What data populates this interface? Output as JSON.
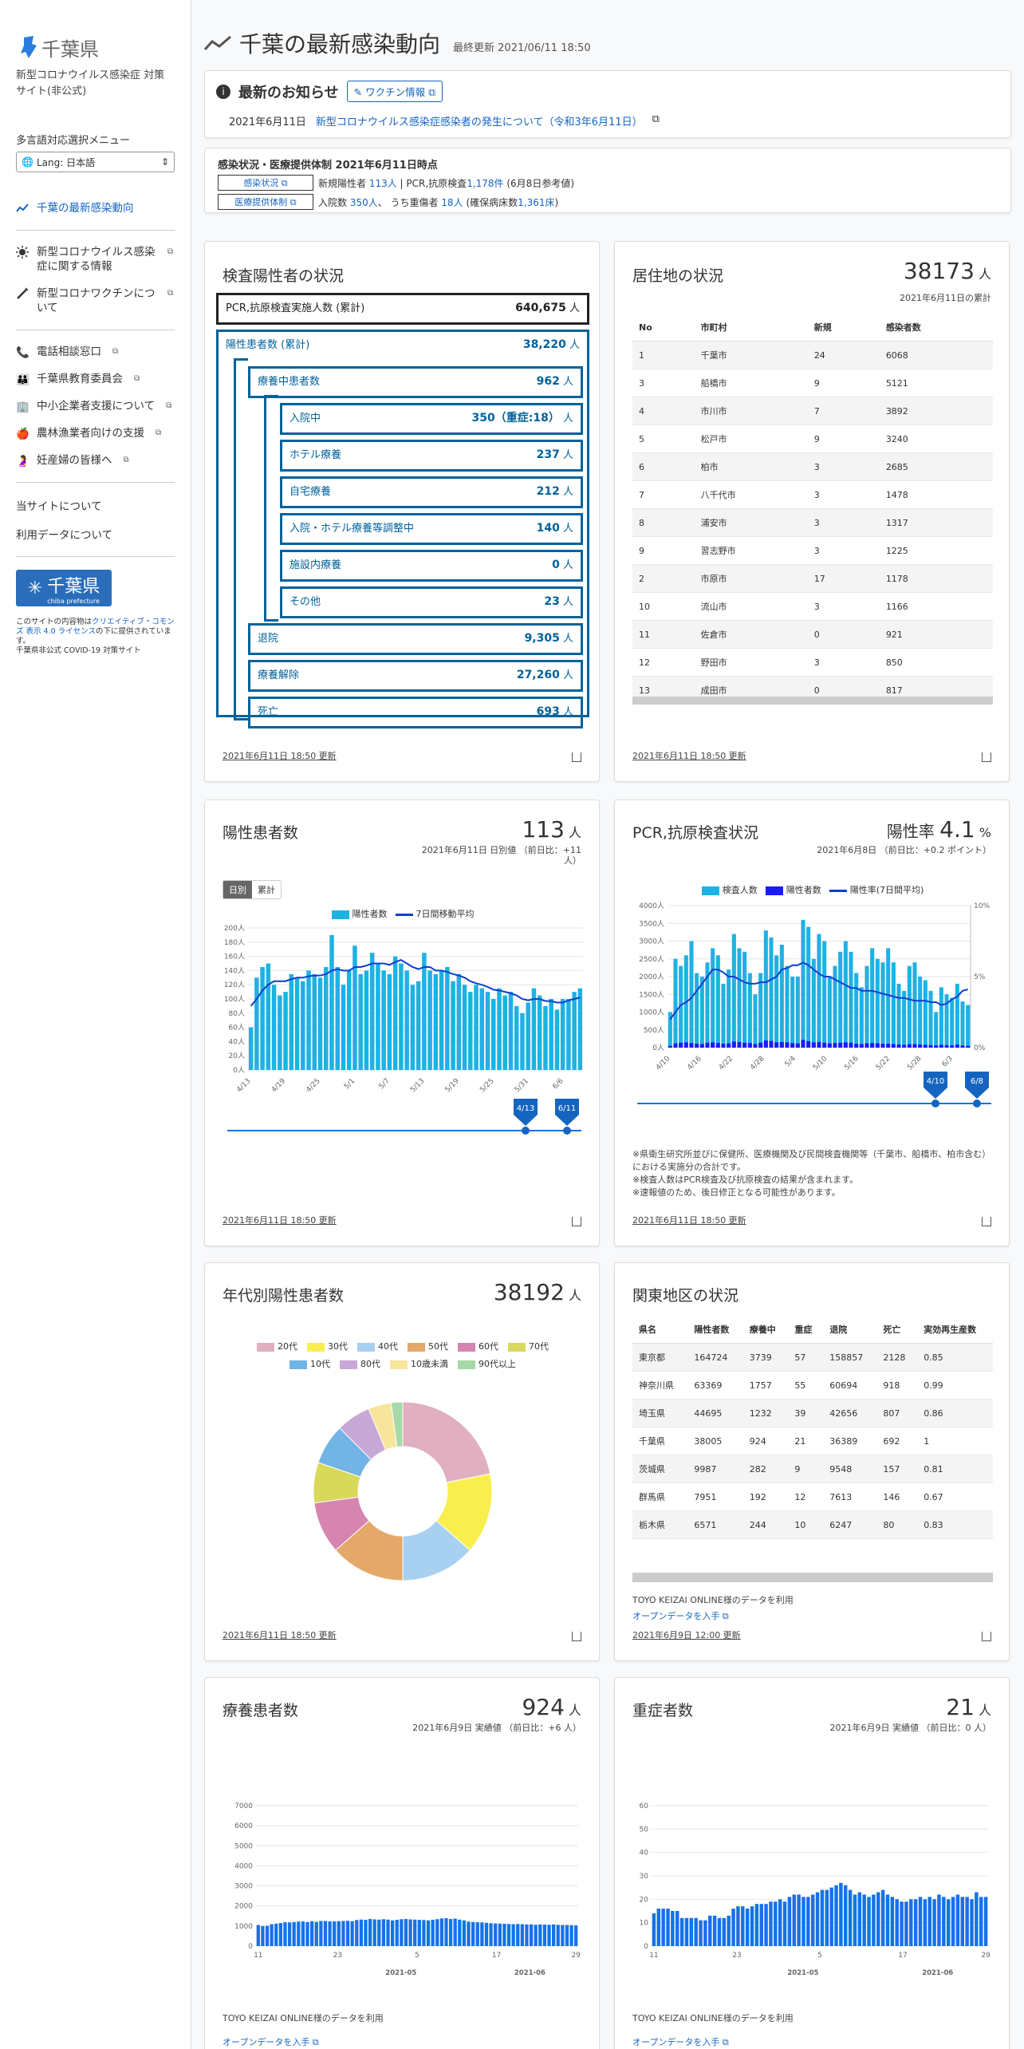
{
  "sidebar": {
    "logo": "千葉県",
    "site_sub": "新型コロナウイルス感染症 対策サイト(非公式)",
    "lang_title": "多言語対応選択メニュー",
    "lang_value": "Lang: 日本語",
    "nav": [
      {
        "label": "千葉の最新感染動向",
        "icon": "chart-line-icon"
      },
      {
        "label": "新型コロナウイルス感染症に関する情報",
        "icon": "sun-icon"
      },
      {
        "label": "新型コロナワクチンについて",
        "icon": "syringe-icon"
      }
    ],
    "nav2": [
      {
        "label": "電話相談窓口",
        "icon": "phone-icon"
      },
      {
        "label": "千葉県教育委員会",
        "icon": "family-icon"
      },
      {
        "label": "中小企業者支援について",
        "icon": "building-icon"
      },
      {
        "label": "農林漁業者向けの支援",
        "icon": "apple-icon"
      },
      {
        "label": "妊産婦の皆様へ",
        "icon": "pregnant-icon"
      }
    ],
    "about": "当サイトについて",
    "data_about": "利用データについて",
    "pref_logo": "千葉県",
    "pref_logo_sub": "chiba prefecture",
    "license_pre": "このサイトの内容物は",
    "license_link": "クリエイティブ・コモンズ 表示 4.0 ライセンス",
    "license_post": "の下に提供されています。",
    "license_last": "千葉県非公式 COVID-19 対策サイト"
  },
  "header": {
    "title": "千葉の最新感染動向",
    "updated": "最終更新 2021/06/11 18:50"
  },
  "news": {
    "title": "最新のお知らせ",
    "vaccine": "ワクチン情報",
    "date": "2021年6月11日",
    "link": "新型コロナウイルス感染症感染者の発生について（令和3年6月11日）"
  },
  "status": {
    "head": "感染状況・医療提供体制 2021年6月11日時点",
    "btn1": "感染状況",
    "btn2": "医療提供体制",
    "l1a": "新規陽性者 ",
    "l1b": "113人",
    "l1c": " | PCR,抗原検査",
    "l1d": "1,178件",
    "l1e": " (6月8日参考値)",
    "l2a": "入院数 ",
    "l2b": "350人",
    "l2c": "、 うち重傷者 ",
    "l2d": "18人",
    "l2e": " (確保病床数",
    "l2f": "1,361床",
    "l2g": ")"
  },
  "inspect": {
    "title": "検査陽性者の状況",
    "footer": "2021年6月11日 18:50 更新",
    "boxes": [
      {
        "label": "PCR,抗原検査実施人数 (累計)",
        "value": "640,675",
        "unit": " 人"
      },
      {
        "label": "陽性患者数 (累計)",
        "value": "38,220",
        "unit": " 人"
      },
      {
        "label": "療養中患者数",
        "value": "962",
        "unit": " 人"
      },
      {
        "label": "入院中",
        "value": "350（重症:18）",
        "unit": " 人"
      },
      {
        "label": "ホテル療養",
        "value": "237",
        "unit": " 人"
      },
      {
        "label": "自宅療養",
        "value": "212",
        "unit": " 人"
      },
      {
        "label": "入院・ホテル療養等調整中",
        "value": "140",
        "unit": " 人"
      },
      {
        "label": "施設内療養",
        "value": "0",
        "unit": " 人"
      },
      {
        "label": "その他",
        "value": "23",
        "unit": " 人"
      },
      {
        "label": "退院",
        "value": "9,305",
        "unit": " 人"
      },
      {
        "label": "療養解除",
        "value": "27,260",
        "unit": " 人"
      },
      {
        "label": "死亡",
        "value": "693",
        "unit": " 人"
      }
    ]
  },
  "residence": {
    "title": "居住地の状況",
    "big": "38173",
    "unit": " 人",
    "sub": "2021年6月11日の累計",
    "footer": "2021年6月11日 18:50 更新",
    "cols": [
      "No",
      "市町村",
      "新規",
      "感染者数"
    ],
    "rows": [
      [
        "1",
        "千葉市",
        "24",
        "6068"
      ],
      [
        "3",
        "船橋市",
        "9",
        "5121"
      ],
      [
        "4",
        "市川市",
        "7",
        "3892"
      ],
      [
        "5",
        "松戸市",
        "9",
        "3240"
      ],
      [
        "6",
        "柏市",
        "3",
        "2685"
      ],
      [
        "7",
        "八千代市",
        "3",
        "1478"
      ],
      [
        "8",
        "浦安市",
        "3",
        "1317"
      ],
      [
        "9",
        "習志野市",
        "3",
        "1225"
      ],
      [
        "2",
        "市原市",
        "17",
        "1178"
      ],
      [
        "10",
        "流山市",
        "3",
        "1166"
      ],
      [
        "11",
        "佐倉市",
        "0",
        "921"
      ],
      [
        "12",
        "野田市",
        "3",
        "850"
      ],
      [
        "13",
        "成田市",
        "0",
        "817"
      ]
    ]
  },
  "positive": {
    "title": "陽性患者数",
    "big": "113",
    "unit": " 人",
    "sub": "2021年6月11日 日別値 （前日比：+11 人）",
    "tog1": "日別",
    "tog2": "累計",
    "footer": "2021年6月11日 18:50 更新",
    "slider_left": "4/13",
    "slider_right": "6/11"
  },
  "pcr": {
    "title": "PCR,抗原検査状況",
    "ratio_label": "陽性率 ",
    "big": "4.1",
    "unit": " %",
    "sub": "2021年6月8日 （前日比：+0.2 ポイント）",
    "footer": "2021年6月11日 18:50 更新",
    "slider_left": "4/10",
    "slider_right": "6/8",
    "notes": [
      "※県衛生研究所並びに保健所、医療機関及び民間検査機関等（千葉市、船橋市、柏市含む）における実施分の合計です。",
      "※検査人数はPCR検査及び抗原検査の結果が含まれます。",
      "※速報値のため、後日修正となる可能性があります。"
    ]
  },
  "age": {
    "title": "年代別陽性患者数",
    "big": "38192",
    "unit": " 人",
    "footer": "2021年6月11日 18:50 更新"
  },
  "kanto": {
    "title": "関東地区の状況",
    "credit": "TOYO KEIZAI ONLINE様のデータを利用",
    "open": "オープンデータを入手",
    "footer": "2021年6月9日 12:00 更新",
    "cols": [
      "県名",
      "陽性者数",
      "療養中",
      "重症",
      "退院",
      "死亡",
      "実効再生産数"
    ],
    "rows": [
      [
        "東京都",
        "164724",
        "3739",
        "57",
        "158857",
        "2128",
        "0.85"
      ],
      [
        "神奈川県",
        "63369",
        "1757",
        "55",
        "60694",
        "918",
        "0.99"
      ],
      [
        "埼玉県",
        "44695",
        "1232",
        "39",
        "42656",
        "807",
        "0.86"
      ],
      [
        "千葉県",
        "38005",
        "924",
        "21",
        "36389",
        "692",
        "1"
      ],
      [
        "茨城県",
        "9987",
        "282",
        "9",
        "9548",
        "157",
        "0.81"
      ],
      [
        "群馬県",
        "7951",
        "192",
        "12",
        "7613",
        "146",
        "0.67"
      ],
      [
        "栃木県",
        "6571",
        "244",
        "10",
        "6247",
        "80",
        "0.83"
      ]
    ]
  },
  "treat": {
    "title": "療養患者数",
    "big": "924",
    "unit": " 人",
    "sub": "2021年6月9日 実績値 （前日比：+6 人）",
    "credit": "TOYO KEIZAI ONLINE様のデータを利用",
    "open": "オープンデータを入手"
  },
  "severe": {
    "title": "重症者数",
    "big": "21",
    "unit": " 人",
    "sub": "2021年6月9日 実績値 （前日比：0 人）",
    "credit": "TOYO KEIZAI ONLINE様のデータを利用",
    "open": "オープンデータを入手"
  },
  "colors": {
    "accent": "#1565c0",
    "box": "#00629b",
    "bar": "#1db2e3",
    "bar_dark": "#0a7bd6"
  },
  "chart_data": [
    {
      "type": "bar",
      "title": "陽性患者数",
      "series": [
        {
          "name": "陽性者数",
          "values": [
            60,
            130,
            145,
            150,
            120,
            105,
            110,
            135,
            130,
            125,
            140,
            135,
            130,
            145,
            190,
            145,
            120,
            140,
            175,
            135,
            140,
            165,
            150,
            140,
            135,
            160,
            150,
            140,
            120,
            125,
            165,
            140,
            135,
            140,
            145,
            125,
            135,
            120,
            110,
            120,
            115,
            110,
            100,
            115,
            105,
            110,
            90,
            80,
            95,
            115,
            105,
            90,
            100,
            85,
            100,
            100,
            110,
            115
          ]
        },
        {
          "name": "7日間移動平均",
          "values": [
            90,
            100,
            112,
            120,
            125,
            125,
            125,
            128,
            130,
            130,
            132,
            133,
            133,
            135,
            140,
            142,
            140,
            140,
            145,
            145,
            147,
            150,
            150,
            150,
            148,
            152,
            155,
            150,
            145,
            142,
            145,
            145,
            140,
            140,
            138,
            135,
            133,
            130,
            125,
            122,
            120,
            117,
            113,
            112,
            110,
            108,
            105,
            100,
            98,
            100,
            100,
            97,
            97,
            95,
            95,
            98,
            100,
            102
          ]
        }
      ],
      "x_ticks": [
        "4/13",
        "4/19",
        "4/25",
        "5/1",
        "5/7",
        "5/13",
        "5/19",
        "5/25",
        "5/31",
        "6/6"
      ],
      "y_ticks": [
        "0人",
        "20人",
        "40人",
        "60人",
        "80人",
        "100人",
        "120人",
        "140人",
        "160人",
        "180人",
        "200人"
      ],
      "ylim": [
        0,
        200
      ]
    },
    {
      "type": "bar",
      "title": "PCR,抗原検査状況",
      "series": [
        {
          "name": "検査人数",
          "values": [
            1000,
            2500,
            2300,
            2600,
            3000,
            2100,
            2000,
            2400,
            2800,
            2600,
            1800,
            2200,
            3200,
            2800,
            2700,
            2100,
            1500,
            2100,
            3300,
            3100,
            2600,
            2900,
            2300,
            2000,
            2000,
            3600,
            3400,
            2500,
            3200,
            3000,
            2000,
            2300,
            2700,
            3000,
            2700,
            2100,
            1700,
            2300,
            2800,
            2500,
            2400,
            2800,
            2400,
            1800,
            1600,
            2300,
            2400,
            2000,
            1900,
            1600,
            1000,
            1700,
            1500,
            1400,
            1800,
            1300,
            1200
          ]
        },
        {
          "name": "陽性者数",
          "values": [
            50,
            120,
            140,
            150,
            130,
            110,
            100,
            140,
            150,
            130,
            110,
            120,
            170,
            160,
            140,
            130,
            100,
            140,
            200,
            190,
            150,
            160,
            150,
            130,
            120,
            220,
            180,
            150,
            160,
            140,
            120,
            130,
            140,
            150,
            140,
            110,
            100,
            120,
            130,
            120,
            110,
            110,
            100,
            90,
            80,
            100,
            100,
            90,
            80,
            70,
            60,
            80,
            70,
            60,
            90,
            60,
            50
          ]
        },
        {
          "name": "陽性率(7日間平均)",
          "values": [
            2,
            2.5,
            3,
            3.2,
            3.5,
            4,
            4.5,
            5,
            5.5,
            5.5,
            5.3,
            5,
            5,
            4.8,
            4.6,
            4.5,
            4.5,
            4.6,
            4.6,
            4.8,
            5,
            5.5,
            5.6,
            5.8,
            5.8,
            6,
            5.8,
            5.5,
            5.2,
            5,
            5,
            4.8,
            4.6,
            4.4,
            4.2,
            4.2,
            4,
            4,
            4,
            3.9,
            3.8,
            3.7,
            3.6,
            3.5,
            3.5,
            3.4,
            3.3,
            3.3,
            3.3,
            3.2,
            3.2,
            3,
            3.1,
            3.4,
            3.6,
            4,
            4.1
          ]
        }
      ],
      "x_ticks": [
        "4/10",
        "4/16",
        "4/22",
        "4/28",
        "5/4",
        "5/10",
        "5/16",
        "5/22",
        "5/28",
        "6/3"
      ],
      "y_ticks": [
        "0人",
        "500人",
        "1000人",
        "1500人",
        "2000人",
        "2500人",
        "3000人",
        "3500人",
        "4000人"
      ],
      "y2_ticks": [
        "0%",
        "5%",
        "10%"
      ],
      "ylim": [
        0,
        4000
      ],
      "y2lim": [
        0,
        10
      ]
    },
    {
      "type": "pie",
      "title": "年代別陽性患者数",
      "categories": [
        "20代",
        "30代",
        "40代",
        "50代",
        "60代",
        "70代",
        "10代",
        "80代",
        "10歳未満",
        "90代以上"
      ],
      "values": [
        21,
        14,
        13,
        13,
        9,
        7,
        7,
        6,
        4,
        2
      ],
      "colors": [
        "#e0b0c0",
        "#f8ef4e",
        "#a8d0f0",
        "#e3a86a",
        "#d585b0",
        "#d8d85a",
        "#72b4e6",
        "#c8a8d6",
        "#f6e59a",
        "#a8d8a8"
      ]
    },
    {
      "type": "bar",
      "title": "療養患者数",
      "values": [
        1050,
        1000,
        1010,
        1090,
        1120,
        1150,
        1190,
        1180,
        1200,
        1220,
        1230,
        1200,
        1240,
        1210,
        1250,
        1250,
        1230,
        1230,
        1240,
        1250,
        1260,
        1240,
        1300,
        1320,
        1310,
        1350,
        1330,
        1320,
        1340,
        1320,
        1280,
        1310,
        1340,
        1350,
        1330,
        1320,
        1310,
        1300,
        1280,
        1310,
        1340,
        1380,
        1390,
        1350,
        1370,
        1320,
        1280,
        1220,
        1200,
        1190,
        1180,
        1160,
        1140,
        1130,
        1120,
        1110,
        1100,
        1090,
        1100,
        1090,
        1080,
        1080,
        1060,
        1080,
        1070,
        1060,
        1080,
        1060,
        1050,
        1050,
        1040,
        1030
      ],
      "x_ticks": [
        "11",
        "23",
        "5",
        "17",
        "29"
      ],
      "months": [
        "2021-05",
        "2021-06"
      ],
      "y_ticks": [
        "0",
        "1000",
        "2000",
        "3000",
        "4000",
        "5000",
        "6000",
        "7000"
      ],
      "ylim": [
        0,
        7000
      ]
    },
    {
      "type": "bar",
      "title": "重症者数",
      "values": [
        14,
        16,
        16,
        16,
        15,
        15,
        12,
        12,
        12,
        12,
        11,
        11,
        13,
        13,
        12,
        12,
        13,
        16,
        17,
        17,
        16,
        17,
        18,
        18,
        18,
        19,
        19,
        20,
        19,
        21,
        22,
        22,
        21,
        21,
        22,
        23,
        24,
        24,
        25,
        26,
        27,
        26,
        24,
        22,
        23,
        22,
        21,
        22,
        23,
        24,
        22,
        21,
        20,
        19,
        19,
        20,
        20,
        21,
        20,
        21,
        20,
        22,
        21,
        20,
        21,
        22,
        21,
        21,
        20,
        23,
        21,
        21
      ],
      "x_ticks": [
        "11",
        "23",
        "5",
        "17",
        "29"
      ],
      "months": [
        "2021-05",
        "2021-06"
      ],
      "y_ticks": [
        "0",
        "10",
        "20",
        "30",
        "40",
        "50",
        "60"
      ],
      "ylim": [
        0,
        60
      ]
    }
  ]
}
